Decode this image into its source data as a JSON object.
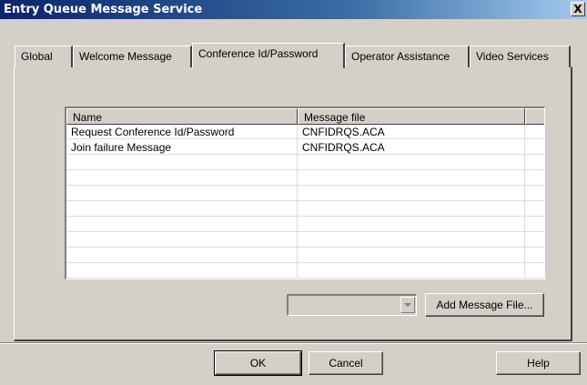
{
  "window": {
    "title": "Entry Queue Message Service",
    "close_label": "X"
  },
  "tabs": [
    {
      "label": "Global",
      "active": false
    },
    {
      "label": "Welcome Message",
      "active": false
    },
    {
      "label": "Conference Id/Password",
      "active": true
    },
    {
      "label": "Operator Assistance",
      "active": false
    },
    {
      "label": "Video Services",
      "active": false
    }
  ],
  "table": {
    "columns": [
      "Name",
      "Message file"
    ],
    "rows": [
      {
        "name": "Request Conference Id/Password",
        "file": "CNFIDRQS.ACA"
      },
      {
        "name": "Join failure Message",
        "file": "CNFIDRQS.ACA"
      }
    ]
  },
  "message_file_combo": {
    "selected": ""
  },
  "buttons": {
    "add_message_file": "Add Message File...",
    "ok": "OK",
    "cancel": "Cancel",
    "help": "Help"
  },
  "icons": {
    "dropdown": "chevron-down-icon",
    "close": "close-icon"
  }
}
